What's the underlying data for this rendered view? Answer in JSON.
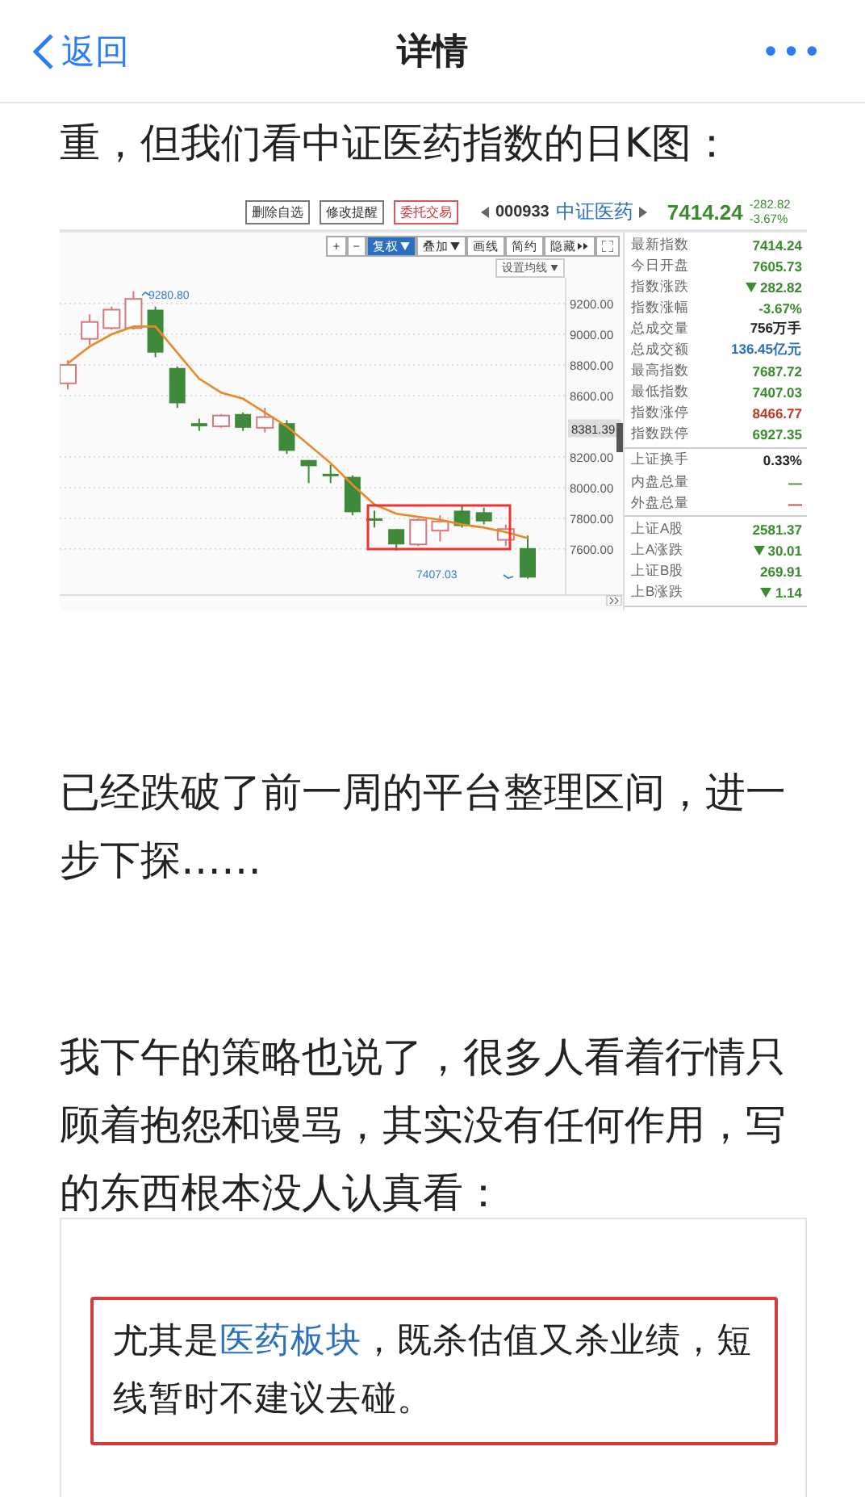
{
  "nav": {
    "back": "返回",
    "title": "详情",
    "more": "•••"
  },
  "paragraph_1": "重，但我们看中证医药指数的日K图：",
  "chart_screenshot": {
    "toolbar": [
      "删除自选",
      "修改提醒",
      "委托交易"
    ],
    "code": "000933",
    "name": "中证医药",
    "price": "7414.24",
    "change": "-282.82",
    "change_pct": "-3.67%",
    "controls": [
      {
        "label": "+",
        "kind": "plain",
        "selected": false
      },
      {
        "label": "−",
        "kind": "plain",
        "selected": false
      },
      {
        "label": "复权",
        "kind": "dropdown",
        "selected": true
      },
      {
        "label": "叠加",
        "kind": "dropdown",
        "selected": false
      },
      {
        "label": "画线",
        "kind": "plain",
        "selected": false
      },
      {
        "label": "简约",
        "kind": "plain",
        "selected": false
      },
      {
        "label": "隐藏",
        "kind": "collapse",
        "selected": false
      }
    ],
    "ma_button": "设置均线",
    "high_label": "9280.80",
    "low_label": "7407.03",
    "price_tag": "8381.39",
    "chart_data": {
      "type": "candlestick",
      "ylim": [
        7305,
        9368
      ],
      "grid": true,
      "ohlc": [
        [
          8680,
          8830,
          8640,
          8800
        ],
        [
          8970,
          9130,
          8930,
          9080
        ],
        [
          9040,
          9180,
          9030,
          9160
        ],
        [
          9040,
          9281,
          9030,
          9230
        ],
        [
          9160,
          9180,
          8850,
          8880
        ],
        [
          8780,
          8790,
          8520,
          8550
        ],
        [
          8420,
          8450,
          8370,
          8400
        ],
        [
          8400,
          8480,
          8390,
          8470
        ],
        [
          8480,
          8490,
          8370,
          8390
        ],
        [
          8390,
          8520,
          8360,
          8460
        ],
        [
          8420,
          8440,
          8220,
          8240
        ],
        [
          8180,
          8180,
          8030,
          8140
        ],
        [
          8090,
          8150,
          8030,
          8080
        ],
        [
          8070,
          8080,
          7820,
          7840
        ],
        [
          7800,
          7850,
          7740,
          7790
        ],
        [
          7730,
          7730,
          7590,
          7630
        ],
        [
          7630,
          7800,
          7620,
          7790
        ],
        [
          7720,
          7820,
          7650,
          7780
        ],
        [
          7850,
          7880,
          7740,
          7750
        ],
        [
          7840,
          7870,
          7760,
          7780
        ],
        [
          7660,
          7760,
          7620,
          7730
        ],
        [
          7606,
          7688,
          7407,
          7414
        ]
      ],
      "yticks": [
        {
          "value": 9200,
          "label": "9200.00"
        },
        {
          "value": 9000,
          "label": "9000.00"
        },
        {
          "value": 8800,
          "label": "8800.00"
        },
        {
          "value": 8600,
          "label": "8600.00"
        },
        {
          "value": 8200,
          "label": "8200.00"
        },
        {
          "value": 8000,
          "label": "8000.00"
        },
        {
          "value": 7800,
          "label": "7800.00"
        },
        {
          "value": 7600,
          "label": "7600.00"
        }
      ],
      "series": [
        {
          "type": "line",
          "color": "#e8892a",
          "values": [
            8810,
            8920,
            9000,
            9050,
            9050,
            8880,
            8710,
            8620,
            8580,
            8490,
            8400,
            8280,
            8160,
            8020,
            7890,
            7830,
            7810,
            7790,
            7760,
            7740,
            7710,
            7670
          ]
        }
      ]
    },
    "stats": [
      [
        {
          "label": "最新指数",
          "value": "7414.24",
          "color": "#3a8a2e",
          "arrow": false
        },
        {
          "label": "今日开盘",
          "value": "7605.73",
          "color": "#3a8a2e",
          "arrow": false
        },
        {
          "label": "指数涨跌",
          "value": "282.82",
          "color": "#3a8a2e",
          "arrow": true
        },
        {
          "label": "指数涨幅",
          "value": "-3.67%",
          "color": "#3a8a2e",
          "arrow": false
        },
        {
          "label": "总成交量",
          "value": "756万手",
          "color": "#222222",
          "arrow": false
        },
        {
          "label": "总成交额",
          "value": "136.45亿元",
          "color": "#2a6fc0",
          "arrow": false
        },
        {
          "label": "最高指数",
          "value": "7687.72",
          "color": "#3a8a2e",
          "arrow": false
        },
        {
          "label": "最低指数",
          "value": "7407.03",
          "color": "#3a8a2e",
          "arrow": false
        },
        {
          "label": "指数涨停",
          "value": "8466.77",
          "color": "#c0392b",
          "arrow": false
        },
        {
          "label": "指数跌停",
          "value": "6927.35",
          "color": "#3a8a2e",
          "arrow": false
        }
      ],
      [
        {
          "label": "上证换手",
          "value": "0.33%",
          "color": "#222222",
          "arrow": false
        },
        {
          "label": "内盘总量",
          "value": "—",
          "color": "#3a8a2e",
          "arrow": false
        },
        {
          "label": "外盘总量",
          "value": "—",
          "color": "#c0392b",
          "arrow": false
        }
      ],
      [
        {
          "label": "上证A股",
          "value": "2581.37",
          "color": "#3a8a2e",
          "arrow": false
        },
        {
          "label": "上A涨跌",
          "value": "30.01",
          "color": "#3a8a2e",
          "arrow": true
        },
        {
          "label": "上证B股",
          "value": "269.91",
          "color": "#3a8a2e",
          "arrow": false
        },
        {
          "label": "上B涨跌",
          "value": "1.14",
          "color": "#3a8a2e",
          "arrow": true
        }
      ]
    ]
  },
  "paragraph_2": "已经跌破了前一周的平台整理区间，进一步下探……",
  "paragraph_3": "我下午的策略也说了，很多人看着行情只顾着抱怨和谩骂，其实没有任何作用，写的东西根本没人认真看：",
  "quote_screenshot": {
    "segments": [
      {
        "text": "尤其是",
        "highlighted": false
      },
      {
        "text": "医药板块",
        "highlighted": true
      },
      {
        "text": "，既杀估值又杀业绩，短线暂时不建议去碰。",
        "highlighted": false
      }
    ]
  }
}
